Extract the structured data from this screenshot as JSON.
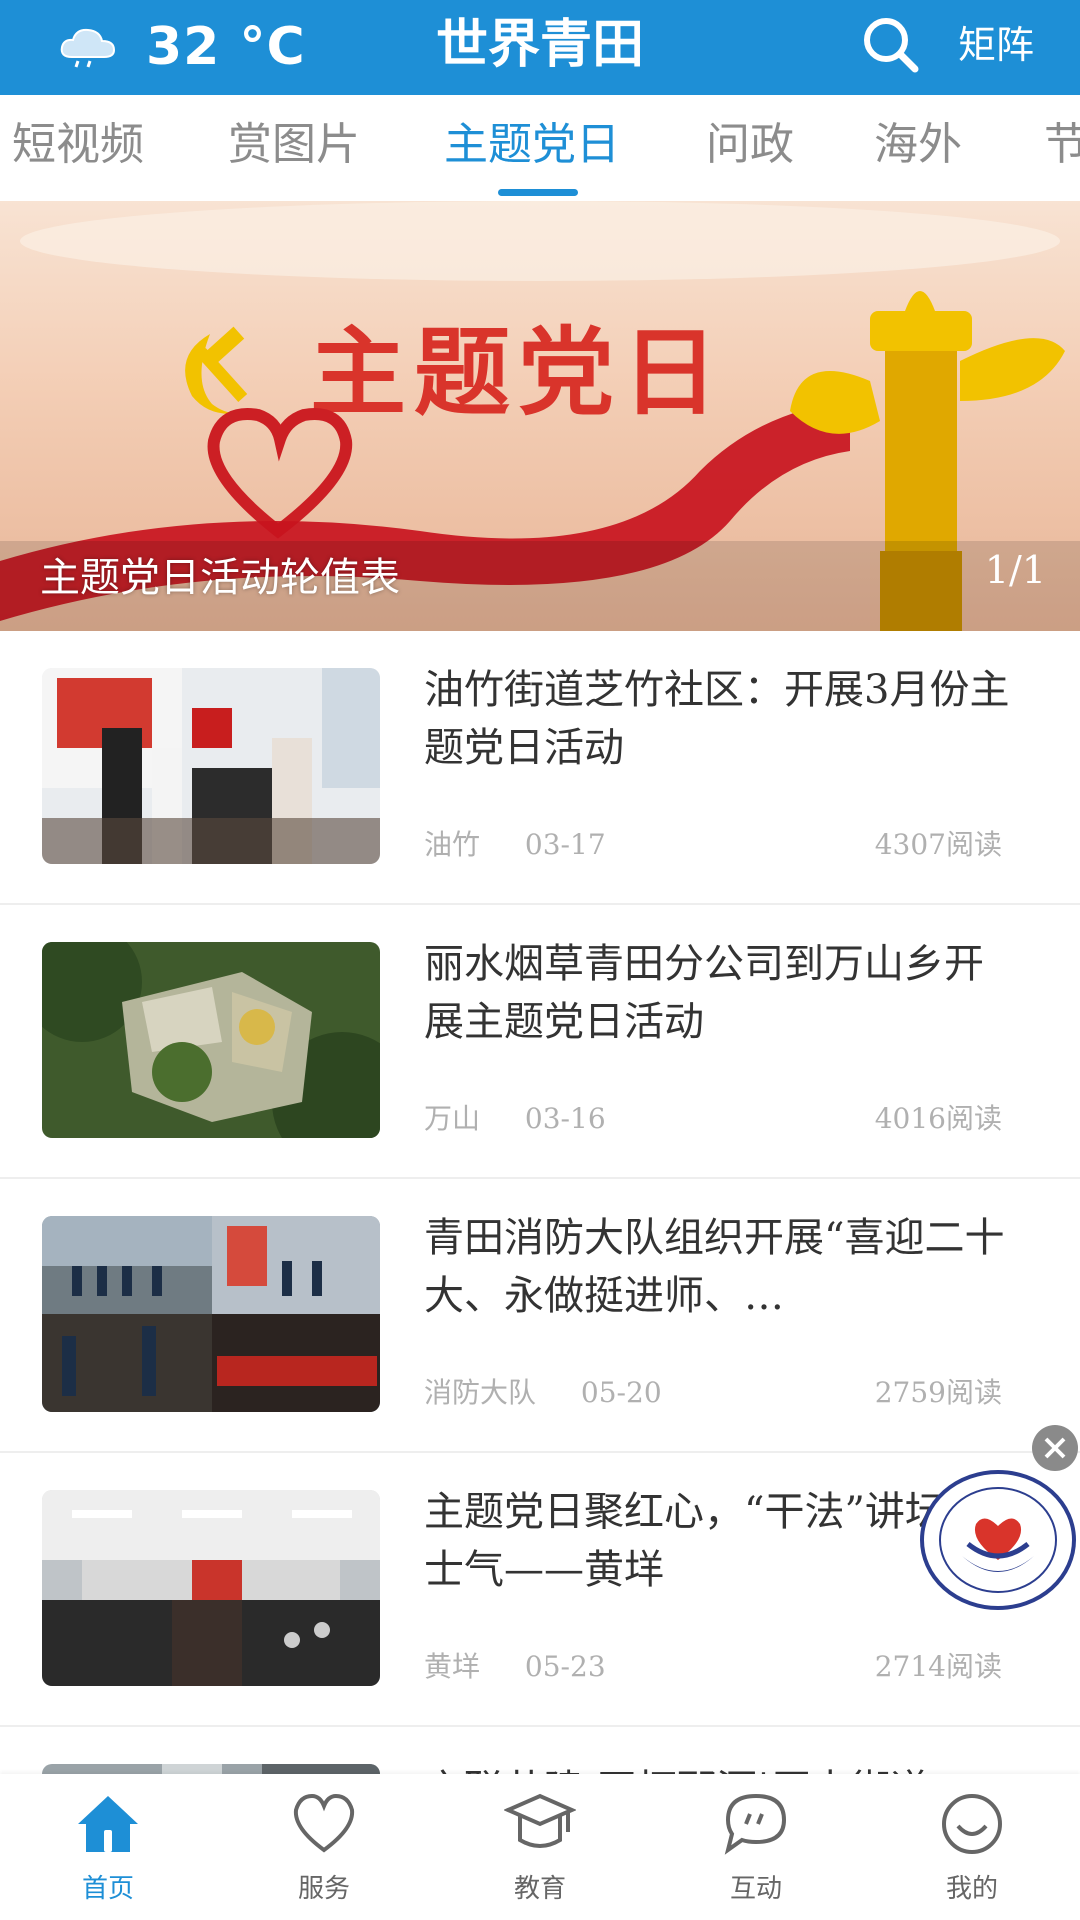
{
  "header": {
    "weather_icon": "cloud-rain-icon",
    "temperature": "32 °C",
    "title": "世界青田",
    "matrix_label": "矩阵"
  },
  "tabs": [
    {
      "label": "短视频",
      "active": false
    },
    {
      "label": "赏图片",
      "active": false
    },
    {
      "label": "主题党日",
      "active": true
    },
    {
      "label": "问政",
      "active": false
    },
    {
      "label": "海外",
      "active": false
    },
    {
      "label": "节",
      "active": false
    }
  ],
  "banner": {
    "headline": "主题党日",
    "caption": "主题党日活动轮值表",
    "counter": "1/1"
  },
  "news": [
    {
      "title": "油竹街道芝竹社区：开展3月份主题党日活动",
      "source": "油竹",
      "date": "03-17",
      "reads": "4307阅读"
    },
    {
      "title": "丽水烟草青田分公司到万山乡开展主题党日活动",
      "source": "万山",
      "date": "03-16",
      "reads": "4016阅读"
    },
    {
      "title": "青田消防大队组织开展“喜迎二十大、永做挺进师、…",
      "source": "消防大队",
      "date": "05-20",
      "reads": "2759阅读"
    },
    {
      "title": "主题党日聚红心，“干法”讲坛提士气——黄垟",
      "source": "黄垟",
      "date": "05-23",
      "reads": "2714阅读"
    }
  ],
  "partial_item_title": "之联共建 开拓那酒|原本街道",
  "badge": {
    "text": "浙江青田之家公益基金会",
    "subtext": "Zhejiang Home Of Qingtian Welfare Foundation"
  },
  "bottom_nav": [
    {
      "label": "首页",
      "icon": "home-icon",
      "active": true
    },
    {
      "label": "服务",
      "icon": "heart-icon",
      "active": false
    },
    {
      "label": "教育",
      "icon": "graduation-cap-icon",
      "active": false
    },
    {
      "label": "互动",
      "icon": "chat-bubble-icon",
      "active": false
    },
    {
      "label": "我的",
      "icon": "smiley-icon",
      "active": false
    }
  ],
  "colors": {
    "brand_blue": "#1e8fd6",
    "party_red": "#d9342b",
    "gold": "#e0a800"
  }
}
